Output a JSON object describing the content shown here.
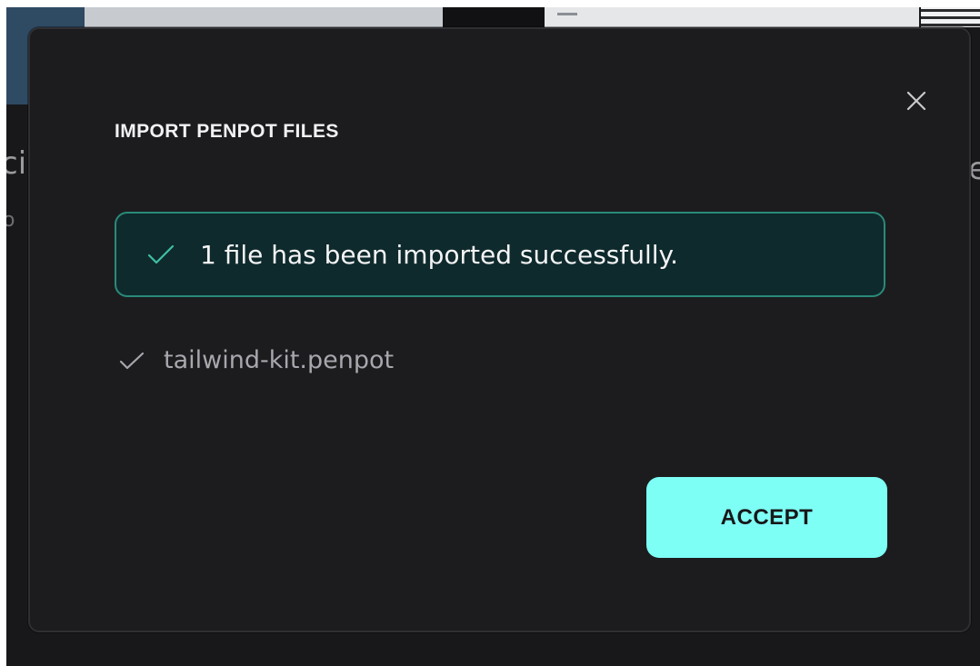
{
  "dialog": {
    "title": "IMPORT PENPOT FILES",
    "close_icon": "close-icon",
    "banner": {
      "icon": "check-icon",
      "message": "1 file has been imported successfully.",
      "accent_color": "#2a8a7a",
      "background_color": "#0f2a2c"
    },
    "files": [
      {
        "icon": "check-icon",
        "name": "tailwind-kit.penpot"
      }
    ],
    "accept_label": "ACCEPT",
    "accept_color": "#7efff5"
  },
  "background": {
    "fragment_left_1": "ci",
    "fragment_left_2": "o",
    "fragment_right": "e"
  }
}
